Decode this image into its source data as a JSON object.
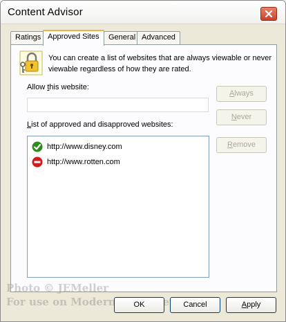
{
  "window": {
    "title": "Content Advisor"
  },
  "tabs": [
    {
      "label": "Ratings"
    },
    {
      "label": "Approved Sites"
    },
    {
      "label": "General"
    },
    {
      "label": "Advanced"
    }
  ],
  "info": {
    "text": "You can create a list of websites that are always viewable or never viewable regardless of how they are rated."
  },
  "allow": {
    "label_prefix": "Allow ",
    "label_mnemonic": "t",
    "label_suffix": "his website:",
    "value": ""
  },
  "buttons": {
    "always": {
      "mnemonic": "A",
      "rest": "lways"
    },
    "never": {
      "mnemonic": "N",
      "rest": "ever"
    },
    "remove": {
      "mnemonic": "R",
      "rest": "emove"
    }
  },
  "list": {
    "label_mnemonic": "L",
    "label_rest": "ist of approved and disapproved websites:",
    "items": [
      {
        "url": "http://www.disney.com",
        "status": "approved",
        "icon": "check-icon"
      },
      {
        "url": "http://www.rotten.com",
        "status": "disapproved",
        "icon": "no-entry-icon"
      }
    ]
  },
  "footer": {
    "ok": "OK",
    "cancel": "Cancel",
    "apply_mnemonic": "A",
    "apply_rest": "pply"
  },
  "watermark": {
    "line1": "Photo © JEMeller",
    "line2": "For use on ModernMagic.net"
  },
  "colors": {
    "approved": "#2e8b1f",
    "disapproved": "#d11a1a",
    "tab_highlight": "#f0b14a",
    "close_button": "#c9422a"
  }
}
